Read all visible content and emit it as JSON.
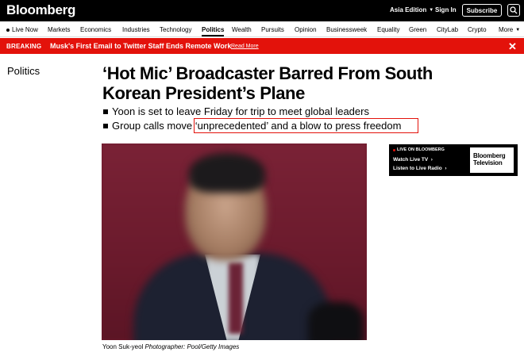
{
  "header": {
    "logo": "Bloomberg",
    "edition": "Asia Edition",
    "signin": "Sign In",
    "subscribe": "Subscribe",
    "search_icon": "search-icon"
  },
  "nav": {
    "live": "Live Now",
    "items": [
      "Markets",
      "Economics",
      "Industries",
      "Technology",
      "Politics",
      "Wealth",
      "Pursuits",
      "Opinion",
      "Businessweek",
      "Equality",
      "Green",
      "CityLab",
      "Crypto"
    ],
    "active": "Politics",
    "more": "More"
  },
  "breaking": {
    "tag": "BREAKING",
    "headline": "Musk's First Email to Twitter Staff Ends Remote Work",
    "readmore": "Read More",
    "accent": "#e3120b"
  },
  "article": {
    "section": "Politics",
    "title": "‘Hot Mic’ Broadcaster Barred From South Korean President’s Plane",
    "abstract": [
      "Yoon is set to leave Friday for trip to meet global leaders",
      "Group calls move ‘unprecedented’ and a blow to press freedom"
    ],
    "caption": "Yoon Suk-yeol",
    "credit": "Photographer: Pool/Getty Images"
  },
  "tv_ad": {
    "live": "LIVE ON BLOOMBERG",
    "watch": "Watch Live TV",
    "listen": "Listen to Live Radio",
    "logo_line1": "Bloomberg",
    "logo_line2": "Television"
  }
}
